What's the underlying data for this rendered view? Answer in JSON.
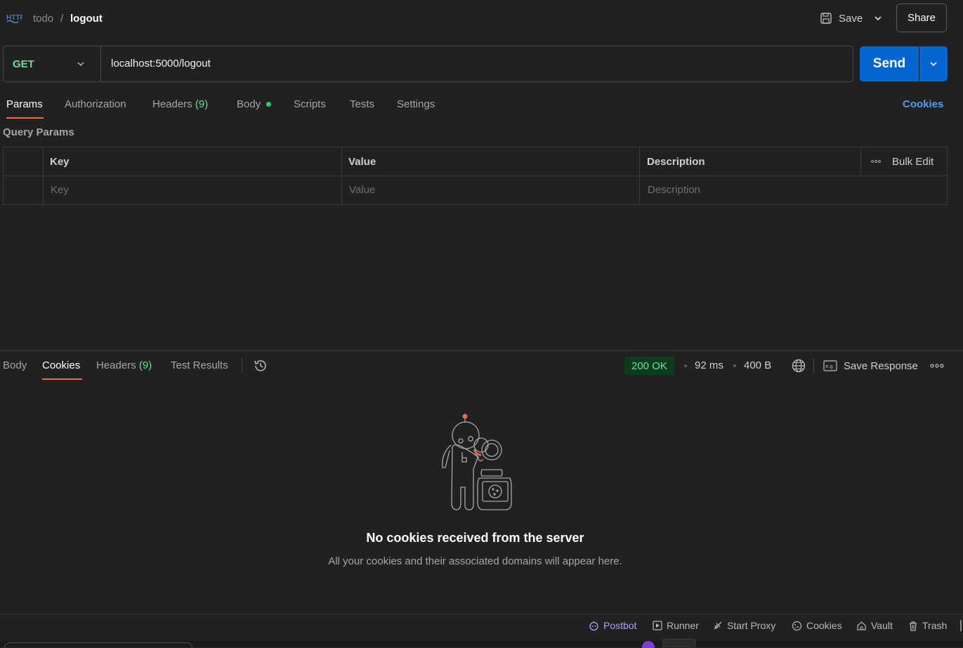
{
  "breadcrumb": {
    "icon": "http-icon",
    "icon_text": "HTTP",
    "parent": "todo",
    "separator": "/",
    "current": "logout"
  },
  "toolbar": {
    "save_label": "Save",
    "share_label": "Share"
  },
  "request": {
    "method": "GET",
    "url": "localhost:5000/logout",
    "send_label": "Send",
    "method_color": "#6bdd9a"
  },
  "request_tabs": {
    "params": "Params",
    "authorization": "Authorization",
    "headers": "Headers",
    "headers_count": "(9)",
    "body": "Body",
    "scripts": "Scripts",
    "tests": "Tests",
    "settings": "Settings",
    "active": "Params",
    "cookies_link": "Cookies"
  },
  "query_params": {
    "title": "Query Params",
    "columns": [
      "Key",
      "Value",
      "Description"
    ],
    "placeholders": [
      "Key",
      "Value",
      "Description"
    ],
    "bulk_edit": "Bulk Edit"
  },
  "response_tabs": {
    "body": "Body",
    "cookies": "Cookies",
    "headers": "Headers",
    "headers_count": "(9)",
    "test_results": "Test Results",
    "active": "Cookies"
  },
  "response_meta": {
    "status": "200 OK",
    "time": "92 ms",
    "size": "400 B",
    "save_response": "Save Response",
    "save_response_icon_text": "e.g."
  },
  "empty_state": {
    "title": "No cookies received from the server",
    "subtitle": "All your cookies and their associated domains will appear here."
  },
  "footer": {
    "postbot": "Postbot",
    "runner": "Runner",
    "start_proxy": "Start Proxy",
    "cookies": "Cookies",
    "vault": "Vault",
    "trash": "Trash"
  },
  "colors": {
    "accent_orange": "#f26b3a",
    "send_blue": "#0265d2",
    "link_blue": "#4b9dff",
    "success_green": "#6bdd9a",
    "postbot_purple": "#b79cff"
  }
}
